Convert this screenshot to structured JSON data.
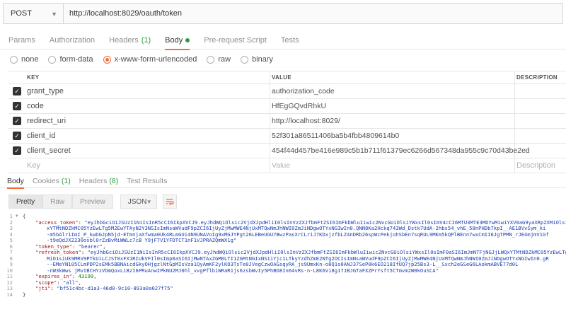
{
  "request": {
    "method": "POST",
    "url": "http://localhost:8029/oauth/token"
  },
  "request_tabs": [
    {
      "label": "Params",
      "active": false
    },
    {
      "label": "Authorization",
      "active": false
    },
    {
      "label": "Headers",
      "count": "(1)",
      "active": false
    },
    {
      "label": "Body",
      "active": true
    },
    {
      "label": "Pre-request Script",
      "active": false
    },
    {
      "label": "Tests",
      "active": false
    }
  ],
  "body_types": [
    "none",
    "form-data",
    "x-www-form-urlencoded",
    "raw",
    "binary"
  ],
  "selected_body_type": "x-www-form-urlencoded",
  "params_table": {
    "headers": {
      "key": "KEY",
      "value": "VALUE",
      "description": "DESCRIPTION"
    },
    "rows": [
      {
        "key": "grant_type",
        "value": "authorization_code",
        "checked": true
      },
      {
        "key": "code",
        "value": "HfEgGQvdRhkU",
        "checked": true
      },
      {
        "key": "redirect_uri",
        "value": "http://localhost:8029/",
        "checked": true
      },
      {
        "key": "client_id",
        "value": "52f301a86511406ba5b4fbb4809614b0",
        "checked": true
      },
      {
        "key": "client_secret",
        "value": "454f44d457be416e989c5b1b711f61379ec6266d567348da955c9c70d43be2ed",
        "checked": true
      }
    ],
    "placeholder": {
      "key": "Key",
      "value": "Value",
      "description": "Description"
    }
  },
  "response_tabs": [
    {
      "label": "Body",
      "active": true
    },
    {
      "label": "Cookies",
      "count": "(1)",
      "active": false
    },
    {
      "label": "Headers",
      "count": "(8)",
      "active": false
    },
    {
      "label": "Test Results",
      "active": false
    }
  ],
  "response_toolbar": {
    "pretty": "Pretty",
    "raw": "Raw",
    "preview": "Preview",
    "format": "JSON",
    "wrap_icon": "wrap-lines-icon"
  },
  "response_code": {
    "line_numbers": [
      "1",
      "2",
      "3",
      "4",
      "5",
      "6",
      "7",
      "8",
      "9",
      "10",
      "11",
      "12",
      "13",
      "14",
      "15",
      "16"
    ],
    "open_brace": "{",
    "close_brace": "}",
    "access_token_key": "\"access_token\"",
    "access_token_lines": [
      "\"eyJhbGciOiJSUzI1NiIsInR5cCI6IkpXVCJ9.eyJhdWQiOlsic2VjdXJpdHliI0lsInVzZXJfbmFtZSI6ImFkbWluIiwic2NvcGUiOlsiYWxsIl0sImV4cCI6MTU3MTE3MDYwMiwiYXV0aG9yaXRpZXMiOlsiYWRtaW4iXSwianRpIjoiYmY1MWM0YmMtZDFhMy00NmQwLTljMTAtODkzYTBhMDI3Zjc1IiwiY2xpZW50X2lkIjoiNTJmMzAxYTg2NTExNDA2YmE1YjRmYmI0ODA5NjE0YjAifQ.",
      "xYTMtNDZkMC05YzEwLTg5M2EwYTAyN2Y3NSIsImNsaWVudF9pZCI6IjUyZjMwMWE4NjUxMTQwNmJhNWI0ZmJiNDgwOTYxNGIwIn0.QNN8Ka2Hckq743Wd_Dstk7UdA-2hbs54_vhE_58nPHDb7kpI__AE1BVvSym_ki",
      "-m5bAlr1ImI_P_kwDGJpN5jd-ETmnjaXfwma0Uk4RLmGUi4N9UNAVoIg9xMGJYPgt26LEBeUGU7BwzPasXrCLriJ7KDxjzfbLZ4nDRb26spWcPekjohSbEn7sqRUL9MKm5kQPlBEnn7wxCmII6JgTPMN_rJE4mjmV1Gf",
      "-t9eQdJX2230osbl0rZzBvMiWWLc7cB Y9jF7V1YFDTCT1nF1VJPRAZQmWX1g\""
    ],
    "token_type_key": "\"token_type\"",
    "token_type_val": "\"bearer\"",
    "refresh_token_key": "\"refresh_token\"",
    "refresh_token_lines": [
      "\"eyJhbGciOiJSUzI1NiIsInR5cCI6IkpXVCJ9.eyJhdWQiOlsic2VjdXJpdHliI0lsInVzZXJfbmFtZSI6ImFkbWluIiwic2NvcGUiOlsiYWxsIl0sImF0aSI6ImJmNTFjNGJjLWQxYTMtNDZkMC05YzEwLTg5M2EwYTAyN2Y3NSIsImV4cCI6MTU3Mzc1MzYwMiwiYXV0aG9yaXRpZXMiOlsiYWRtaW4iXSwianRpIjoiMjgxNTIwZTgtZDk4Yy00ZTAwLWE3NmMtZTI1ZmVlNTc2NmIwIiwiY2xpZW50X2lkIjoiNTJmMzAxYTg2NTExNDA2YmE1YjRmYmI0ODA5NjE0YjAifQ.",
      "MiO1siUk9MRV9PTkUiLCJST0xFX1RIUkVFIl0sImp0aSI6IjMwNTAxZGM0LTI1ZGMtNGIxNS1iYjc1LTkyYzdhZmE2NTg2OCIsImNsaWVudF9pZCI6IjUyZjMwMWE4NjUxMTQwNmJhNWI0ZmJiNDgwOTYxNGIwIn0.gR",
      "--EMeYN105CLmPDP2sEMk5BBNAicdGkyOHjgzlNtGpMIsVza1QyAmKF2ylKO3TsTe0JVegCzwOAGsqyRA_js9UmxKn-o8Q1s0ANJ37SeP0k6EO218IfUQ7jp25Bs3-L__Sxch2eGSeG6LAokmABVE77d0L",
      "-nW3kWws jMvIBCHYzVDmQoxLiBzI6PRuAnwIPkNU2MJ0hl_vvgPflbiWRaR1js6zsbWvIy5PhBO8In64vRs-n-L8K6Vi8g17JBJGTaFXZPrYsft5CTmvm2W0kOuSCA\""
    ],
    "expires_in_key": "\"expires_in\"",
    "expires_in_val": "43199",
    "scope_key": "\"scope\"",
    "scope_val": "\"all\"",
    "jti_key": "\"jti\"",
    "jti_val": "\"bf51c4bc-d1a3-46d0-9c10-893a0a027f75\""
  },
  "colors": {
    "accent": "#f26b3a",
    "count_green": "#2a9d3a",
    "json_key": "#a31515",
    "json_string": "#1c3fb0",
    "json_number": "#0b7a0b"
  }
}
